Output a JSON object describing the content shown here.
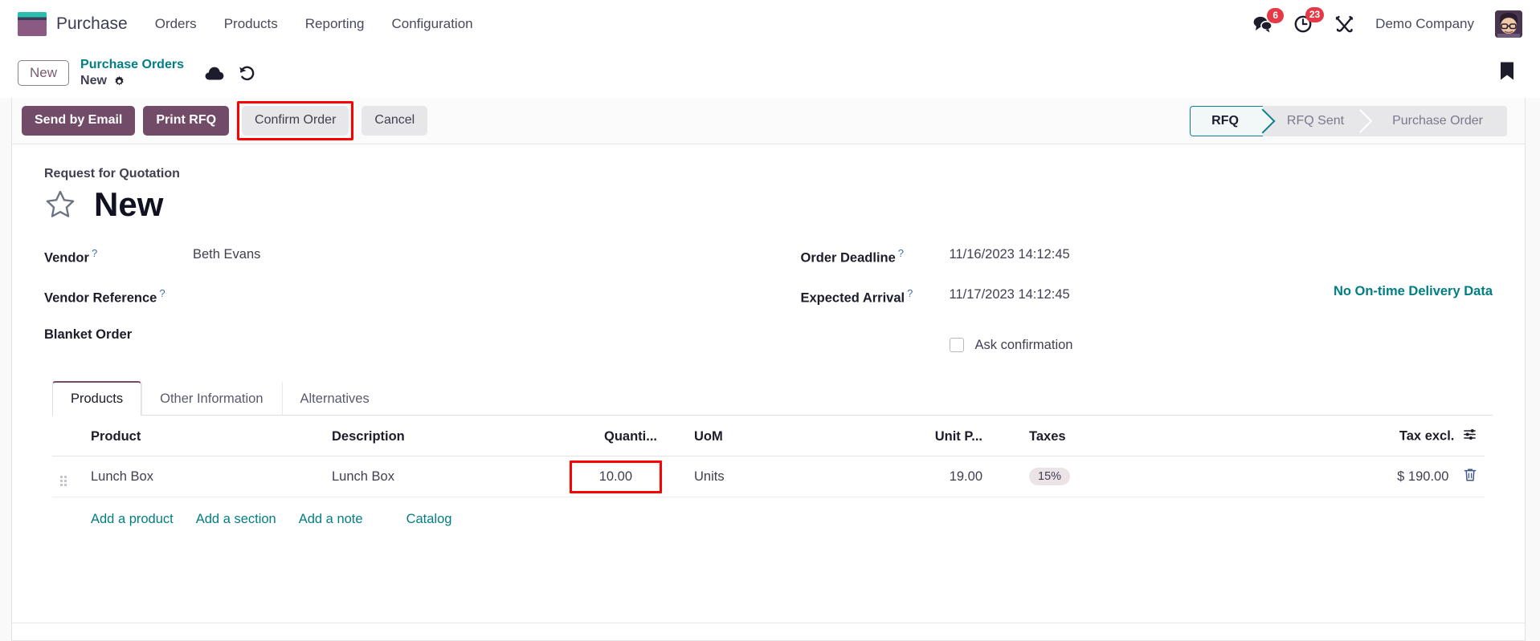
{
  "navbar": {
    "brand": "Purchase",
    "menu": [
      {
        "label": "Orders"
      },
      {
        "label": "Products"
      },
      {
        "label": "Reporting"
      },
      {
        "label": "Configuration"
      }
    ],
    "messages_badge": "6",
    "activities_badge": "23",
    "company": "Demo Company"
  },
  "breadcrumb": {
    "new_button": "New",
    "parent": "Purchase Orders",
    "current": "New"
  },
  "action_bar": {
    "send_by_email": "Send by Email",
    "print_rfq": "Print RFQ",
    "confirm_order": "Confirm Order",
    "cancel": "Cancel",
    "status_steps": [
      {
        "label": "RFQ",
        "active": true
      },
      {
        "label": "RFQ Sent",
        "active": false
      },
      {
        "label": "Purchase Order",
        "active": false
      }
    ]
  },
  "form": {
    "doc_type_label": "Request for Quotation",
    "title": "New",
    "left_fields": [
      {
        "label": "Vendor",
        "help": "?",
        "value": "Beth Evans"
      },
      {
        "label": "Vendor Reference",
        "help": "?",
        "value": ""
      },
      {
        "label": "Blanket Order",
        "help": "",
        "value": ""
      }
    ],
    "right_fields": [
      {
        "label": "Order Deadline",
        "help": "?",
        "value": "11/16/2023 14:12:45"
      },
      {
        "label": "Expected Arrival",
        "help": "?",
        "value": "11/17/2023 14:12:45"
      }
    ],
    "ask_confirmation_label": "Ask confirmation",
    "ask_confirmation_checked": false,
    "delivery_note": "No On-time Delivery Data"
  },
  "tabs": [
    {
      "label": "Products",
      "active": true
    },
    {
      "label": "Other Information",
      "active": false
    },
    {
      "label": "Alternatives",
      "active": false
    }
  ],
  "lines_table": {
    "columns": [
      "Product",
      "Description",
      "Quanti...",
      "UoM",
      "Unit P...",
      "Taxes",
      "Tax excl."
    ],
    "rows": [
      {
        "product": "Lunch Box",
        "description": "Lunch Box",
        "quantity": "10.00",
        "uom": "Units",
        "unit_price": "19.00",
        "taxes": "15%",
        "tax_excl": "$ 190.00"
      }
    ],
    "add_links": [
      "Add a product",
      "Add a section",
      "Add a note"
    ],
    "catalog_link": "Catalog"
  },
  "colors": {
    "brand_purple": "#714b67",
    "teal_link": "#017e84",
    "highlight_red": "#ff0000",
    "badge_red": "#e63946"
  }
}
